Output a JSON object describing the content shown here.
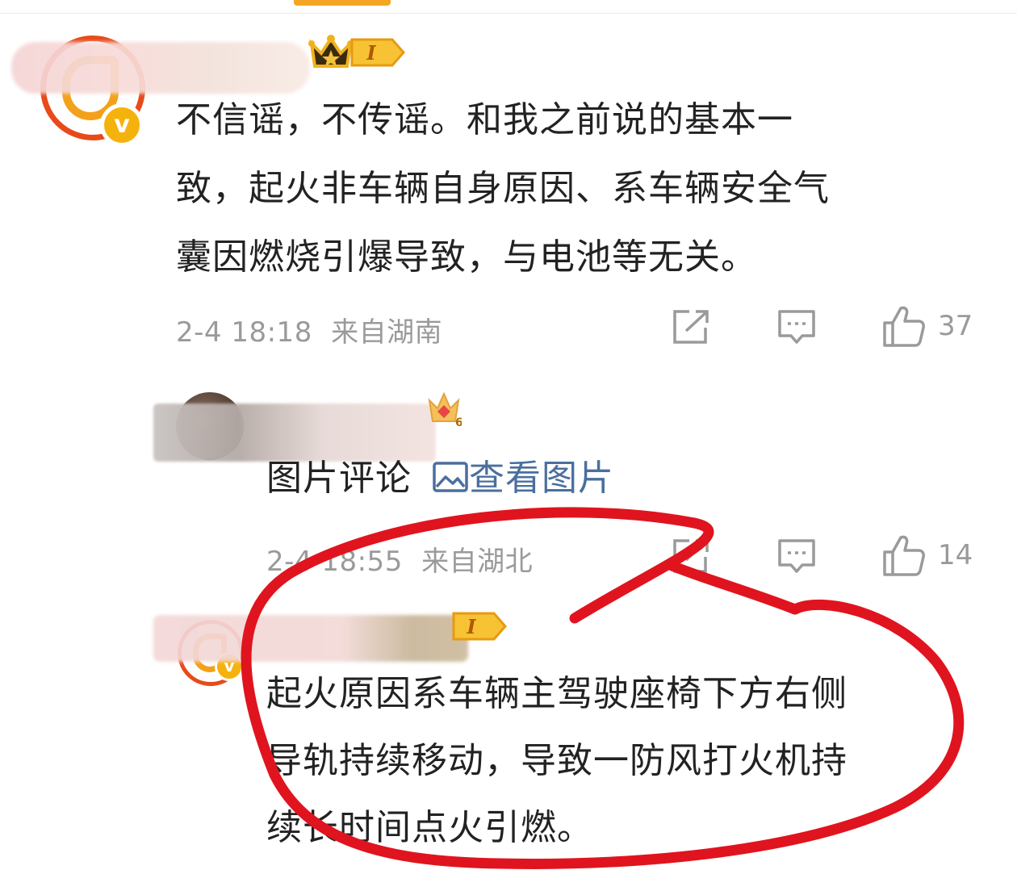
{
  "comments": [
    {
      "badge_level": "I",
      "text_lines": [
        "不信谣，不传谣。和我之前说的基本一",
        "致，起火非车辆自身原因、系车辆安全气",
        "囊因燃烧引爆导致，与电池等无关。"
      ],
      "date": "2-4 18:18",
      "location": "来自湖南",
      "likes": "37"
    },
    {
      "badge_level": "6",
      "text_prefix": "图片评论",
      "link_text": "查看图片",
      "date": "2-4 18:55",
      "location": "来自湖北",
      "likes": "14"
    },
    {
      "badge_level": "I",
      "text_lines": [
        "起火原因系车辆主驾驶座椅下方右侧",
        "导轨持续移动，导致一防风打火机持",
        "续长时间点火引燃。"
      ]
    }
  ],
  "icons": {
    "share": "share-icon",
    "comment": "comment-icon",
    "like": "thumbs-up-icon",
    "image": "image-icon",
    "crown": "crown-icon",
    "verified": "verified-v-icon"
  },
  "colors": {
    "accent_orange": "#f5a623",
    "link_blue": "#4a6f9e",
    "annotation_red": "#e0141e",
    "meta_gray": "#9a9a9a"
  }
}
